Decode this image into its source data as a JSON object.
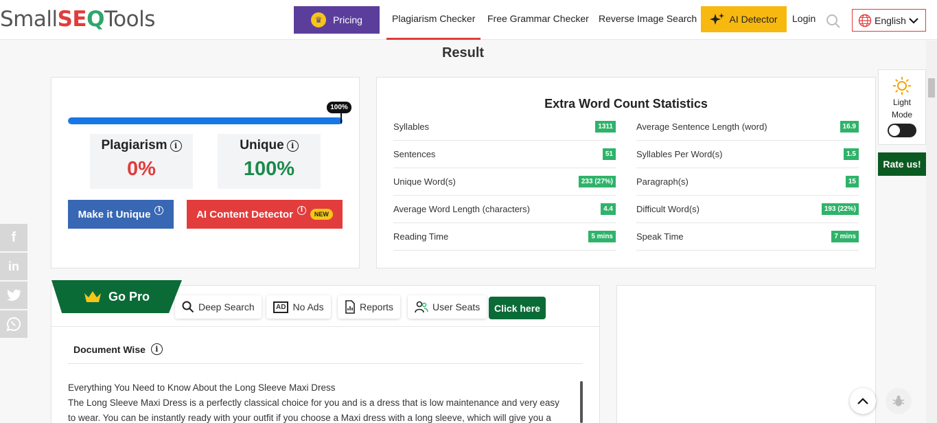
{
  "header": {
    "logo": {
      "small": "Small",
      "seo": "SE",
      "q": "Q",
      "tools": "Tools"
    },
    "pricing_label": "Pricing",
    "nav": [
      "Plagiarism Checker",
      "Free Grammar Checker",
      "Reverse Image Search"
    ],
    "ai_detector_label": "AI Detector",
    "login_label": "Login",
    "language": "English"
  },
  "result_title": "Result",
  "plagiarism_card": {
    "progress_label": "100%",
    "progress_fraction": 1.0,
    "plagiarism_label": "Plagiarism",
    "plagiarism_value": "0%",
    "unique_label": "Unique",
    "unique_value": "100%",
    "make_unique_label": "Make it Unique",
    "ai_content_label": "AI Content Detector",
    "new_badge": "NEW"
  },
  "stats": {
    "title": "Extra Word Count Statistics",
    "left": [
      {
        "label": "Syllables",
        "value": "1311"
      },
      {
        "label": "Sentences",
        "value": "51"
      },
      {
        "label": "Unique Word(s)",
        "value": "233 (27%)"
      },
      {
        "label": "Average Word Length (characters)",
        "value": "4.4"
      },
      {
        "label": "Reading Time",
        "value": "5 mins"
      }
    ],
    "right": [
      {
        "label": "Average Sentence Length (word)",
        "value": "16.9"
      },
      {
        "label": "Syllables Per Word(s)",
        "value": "1.5"
      },
      {
        "label": "Paragraph(s)",
        "value": "15"
      },
      {
        "label": "Difficult Word(s)",
        "value": "193 (22%)"
      },
      {
        "label": "Speak Time",
        "value": "7 mins"
      }
    ]
  },
  "side": {
    "light_label": "Light",
    "mode_label": "Mode",
    "rate_label": "Rate us!"
  },
  "pro": {
    "go_pro_label": "Go Pro",
    "features": [
      "Deep Search",
      "No Ads",
      "Reports",
      "User Seats"
    ],
    "ad_icon_text": "AD",
    "click_label": "Click here"
  },
  "document": {
    "heading": "Document Wise",
    "lines": [
      "Everything You Need to Know About the Long Sleeve Maxi Dress",
      "The Long Sleeve Maxi Dress is a perfectly classical choice for you and is a dress that is low maintenance and very easy",
      "to wear. You can be instantly ready with your outfit if you choose a Maxi dress with a long sleeve, which will give you a"
    ]
  },
  "colors": {
    "brand_red": "#e23b3b",
    "pricing_purple": "#5b3e9c",
    "ai_yellow": "#f7b90f",
    "progress_blue": "#1677e5",
    "plagiarism_red": "#e23b3b",
    "unique_green": "#1a8a4a",
    "make_unique_blue": "#3867b4",
    "ai_content_red": "#e33c3c",
    "stat_green": "#2fb36a",
    "pro_green": "#0b6b37"
  }
}
